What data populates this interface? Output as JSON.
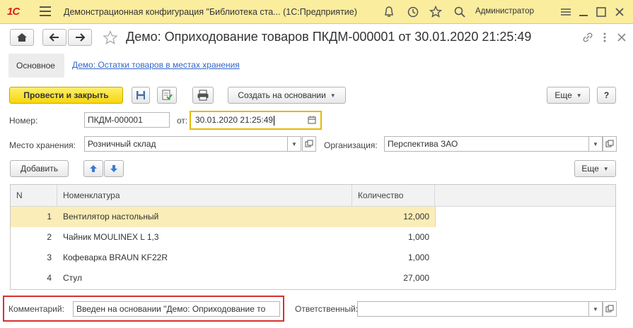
{
  "app": {
    "logo": "1С",
    "title": "Демонстрационная конфигурация \"Библиотека ста...  (1С:Предприятие)",
    "user": "Администратор"
  },
  "document": {
    "title": "Демо: Оприходование товаров ПКДМ-000001 от 30.01.2020 21:25:49"
  },
  "tabs": {
    "main": "Основное",
    "link": "Демо: Остатки товаров в местах хранения"
  },
  "toolbar": {
    "post_close": "Провести и закрыть",
    "create_based": "Создать на основании",
    "more": "Еще",
    "help": "?"
  },
  "form": {
    "number_label": "Номер:",
    "number_value": "ПКДМ-000001",
    "date_label": "от:",
    "date_value": "30.01.2020 21:25:49",
    "storage_label": "Место хранения:",
    "storage_value": "Розничный склад",
    "org_label": "Организация:",
    "org_value": "Перспектива ЗАО",
    "comment_label": "Комментарий:",
    "comment_value": "Введен на основании \"Демо: Оприходование то",
    "responsible_label": "Ответственный:",
    "responsible_value": ""
  },
  "table_toolbar": {
    "add": "Добавить",
    "more": "Еще"
  },
  "table": {
    "columns": [
      "N",
      "Номенклатура",
      "Количество"
    ],
    "rows": [
      {
        "n": "1",
        "item": "Вентилятор настольный",
        "qty": "12,000"
      },
      {
        "n": "2",
        "item": "Чайник MOULINEX L 1,3",
        "qty": "1,000"
      },
      {
        "n": "3",
        "item": "Кофеварка BRAUN KF22R",
        "qty": "1,000"
      },
      {
        "n": "4",
        "item": "Стул",
        "qty": "27,000"
      }
    ]
  },
  "colors": {
    "accent": "#f5d60f",
    "titlebar": "#fbed9e",
    "link": "#3366cc",
    "selected_row": "#fbedb7",
    "highlight_frame": "#d93030"
  }
}
